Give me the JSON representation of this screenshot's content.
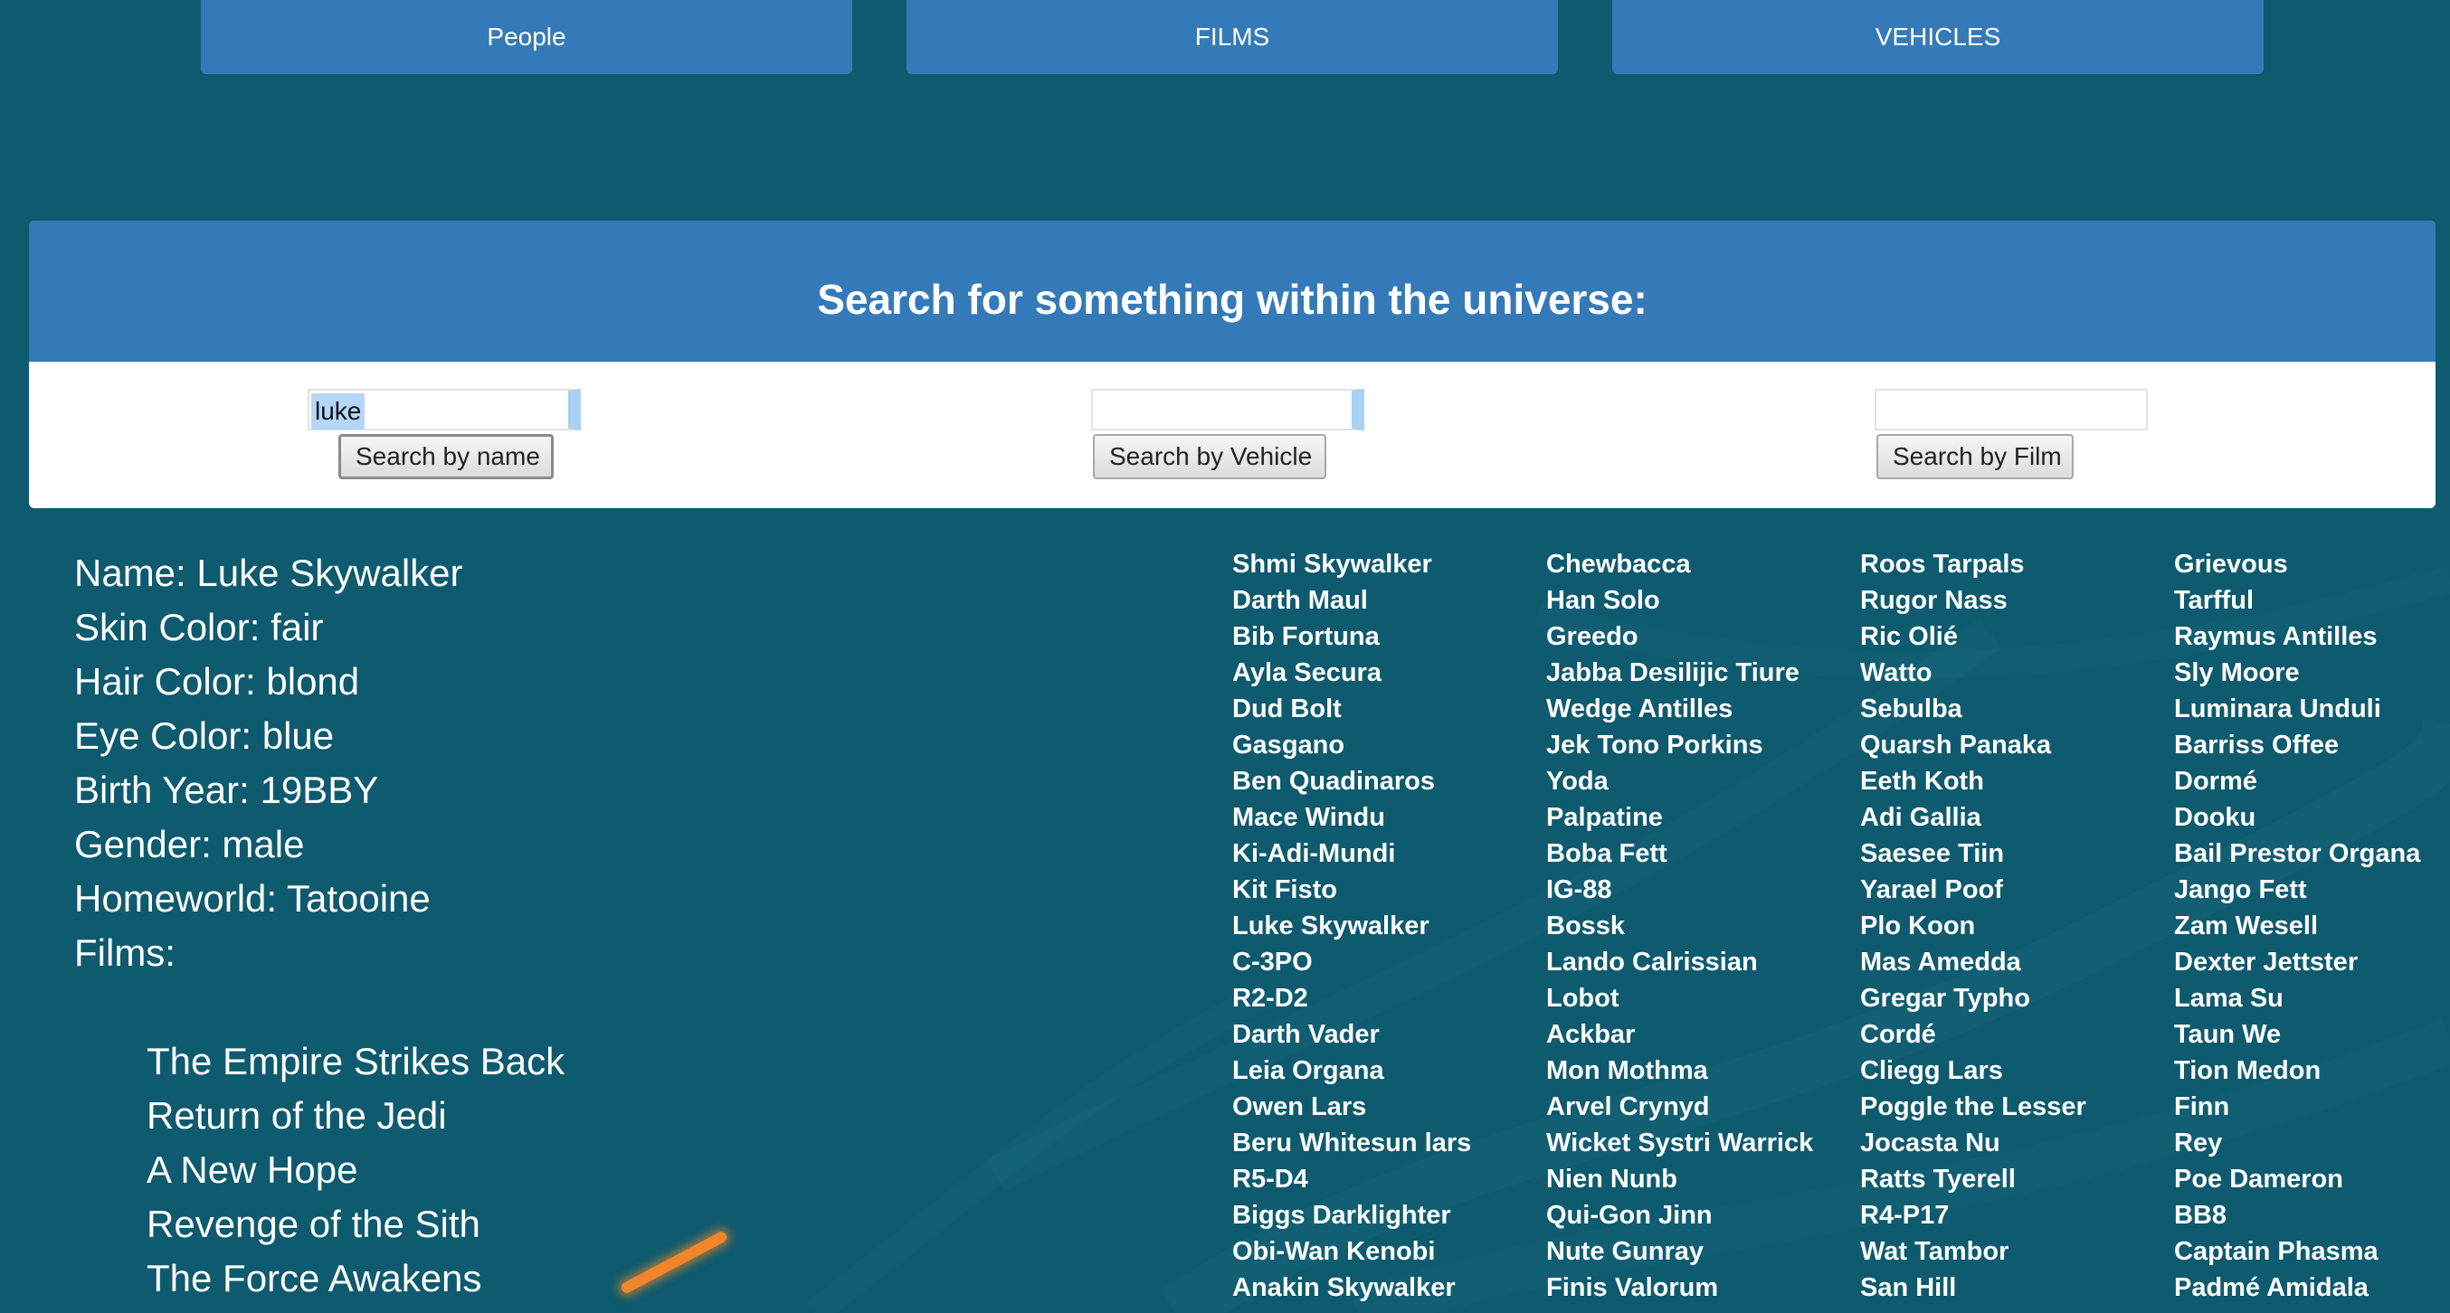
{
  "nav": {
    "people": "People",
    "films": "FILMS",
    "vehicles": "VEHICLES"
  },
  "search": {
    "title": "Search for something within the universe:",
    "name": {
      "value": "luke",
      "button": "Search by name"
    },
    "vehicle": {
      "value": "",
      "button": "Search by Vehicle"
    },
    "film": {
      "value": "",
      "button": "Search by Film"
    }
  },
  "details": {
    "name": "Name: Luke Skywalker",
    "skin": "Skin Color: fair",
    "hair": "Hair Color: blond",
    "eye": "Eye Color: blue",
    "birth": "Birth Year: 19BBY",
    "gender": "Gender: male",
    "homeworld": "Homeworld: Tatooine",
    "films_label": "Films:",
    "films": [
      "The Empire Strikes Back",
      "Return of the Jedi",
      "A New Hope",
      "Revenge of the Sith",
      "The Force Awakens"
    ]
  },
  "people_columns": [
    [
      "Shmi Skywalker",
      "Darth Maul",
      "Bib Fortuna",
      "Ayla Secura",
      "Dud Bolt",
      "Gasgano",
      "Ben Quadinaros",
      "Mace Windu",
      "Ki-Adi-Mundi",
      "Kit Fisto",
      "Luke Skywalker",
      "C-3PO",
      "R2-D2",
      "Darth Vader",
      "Leia Organa",
      "Owen Lars",
      "Beru Whitesun lars",
      "R5-D4",
      "Biggs Darklighter",
      "Obi-Wan Kenobi",
      "Anakin Skywalker"
    ],
    [
      "Chewbacca",
      "Han Solo",
      "Greedo",
      "Jabba Desilijic Tiure",
      "Wedge Antilles",
      "Jek Tono Porkins",
      "Yoda",
      "Palpatine",
      "Boba Fett",
      "IG-88",
      "Bossk",
      "Lando Calrissian",
      "Lobot",
      "Ackbar",
      "Mon Mothma",
      "Arvel Crynyd",
      "Wicket Systri Warrick",
      "Nien Nunb",
      "Qui-Gon Jinn",
      "Nute Gunray",
      "Finis Valorum"
    ],
    [
      "Roos Tarpals",
      "Rugor Nass",
      "Ric Olié",
      "Watto",
      "Sebulba",
      "Quarsh Panaka",
      "Eeth Koth",
      "Adi Gallia",
      "Saesee Tiin",
      "Yarael Poof",
      "Plo Koon",
      "Mas Amedda",
      "Gregar Typho",
      "Cordé",
      "Cliegg Lars",
      "Poggle the Lesser",
      "Jocasta Nu",
      "Ratts Tyerell",
      "R4-P17",
      "Wat Tambor",
      "San Hill"
    ],
    [
      "Grievous",
      "Tarfful",
      "Raymus Antilles",
      "Sly Moore",
      "Luminara Unduli",
      "Barriss Offee",
      "Dormé",
      "Dooku",
      "Bail Prestor Organa",
      "Jango Fett",
      "Zam Wesell",
      "Dexter Jettster",
      "Lama Su",
      "Taun We",
      "Tion Medon",
      "Finn",
      "Rey",
      "Poe Dameron",
      "BB8",
      "Captain Phasma",
      "Padmé Amidala"
    ]
  ],
  "colors": {
    "background": "#0e5a6e",
    "accent": "#357ab8",
    "text": "#ffffff"
  }
}
